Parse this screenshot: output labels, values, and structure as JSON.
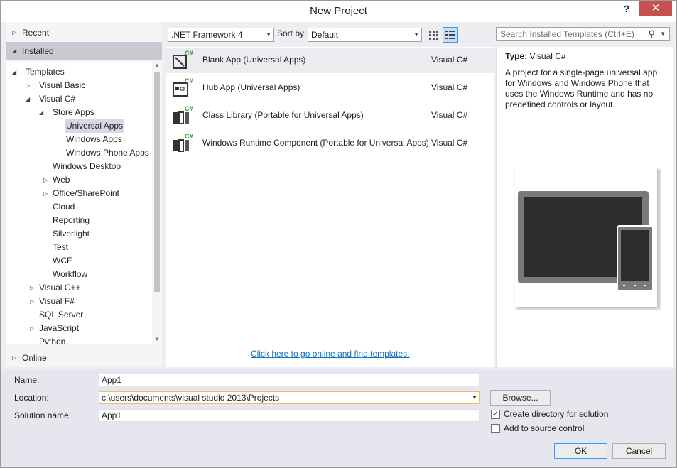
{
  "window": {
    "title": "New Project",
    "help_label": "?",
    "close_label": "✕"
  },
  "left": {
    "recent": "Recent",
    "installed": "Installed",
    "online": "Online",
    "tree": [
      {
        "label": "Templates",
        "arrow": "◢"
      },
      {
        "label": "Visual Basic",
        "arrow": "▷"
      },
      {
        "label": "Visual C#",
        "arrow": "◢"
      },
      {
        "label": "Store Apps",
        "arrow": "◢"
      },
      {
        "label": "Universal Apps",
        "selected": true
      },
      {
        "label": "Windows Apps"
      },
      {
        "label": "Windows Phone Apps"
      },
      {
        "label": "Windows Desktop"
      },
      {
        "label": "Web",
        "arrow": "▷"
      },
      {
        "label": "Office/SharePoint",
        "arrow": "▷"
      },
      {
        "label": "Cloud"
      },
      {
        "label": "Reporting"
      },
      {
        "label": "Silverlight"
      },
      {
        "label": "Test"
      },
      {
        "label": "WCF"
      },
      {
        "label": "Workflow"
      },
      {
        "label": "Visual C++",
        "arrow": "▷"
      },
      {
        "label": "Visual F#",
        "arrow": "▷"
      },
      {
        "label": "SQL Server"
      },
      {
        "label": "JavaScript",
        "arrow": "▷"
      },
      {
        "label": "Python"
      }
    ]
  },
  "toolbar": {
    "framework": ".NET Framework 4",
    "sort_label": "Sort by:",
    "sort_value": "Default",
    "search_placeholder": "Search Installed Templates (Ctrl+E)"
  },
  "templates": [
    {
      "name": "Blank App (Universal Apps)",
      "lang": "Visual C#",
      "icon": "blank-app-icon",
      "selected": true
    },
    {
      "name": "Hub App (Universal Apps)",
      "lang": "Visual C#",
      "icon": "hub-app-icon"
    },
    {
      "name": "Class Library (Portable for Universal Apps)",
      "lang": "Visual C#",
      "icon": "class-library-icon"
    },
    {
      "name": "Windows Runtime Component (Portable for Universal Apps)",
      "lang": "Visual C#",
      "icon": "runtime-component-icon"
    }
  ],
  "online_link": "Click here to go online and find templates.",
  "details": {
    "type_label": "Type:",
    "type_value": "Visual C#",
    "description": "A project for a single-page universal app for Windows and Windows Phone that uses the Windows Runtime and has no predefined controls or layout."
  },
  "form": {
    "name_label": "Name:",
    "name_value": "App1",
    "location_label": "Location:",
    "location_value": "c:\\users\\documents\\visual studio 2013\\Projects",
    "solution_label": "Solution name:",
    "solution_value": "App1",
    "browse_label": "Browse...",
    "create_dir_label": "Create directory for solution",
    "create_dir_checked": true,
    "source_control_label": "Add to source control",
    "source_control_checked": false,
    "ok_label": "OK",
    "cancel_label": "Cancel"
  },
  "colors": {
    "accent": "#3399ff",
    "link": "#0e70c0",
    "close": "#c75050",
    "csharp": "#388a34"
  }
}
